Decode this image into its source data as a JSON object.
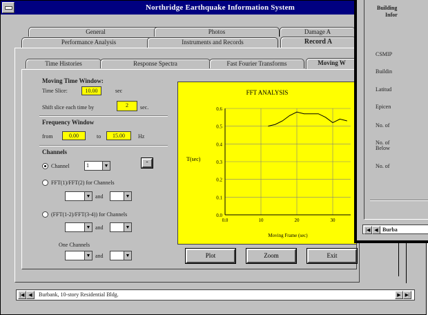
{
  "window": {
    "title": "Northridge Earthquake Information System"
  },
  "tabs_row1": [
    "General",
    "Photos",
    "Damage A"
  ],
  "tabs_row2": [
    "Performance Analysis",
    "Instruments and Records",
    "Record A"
  ],
  "tabs_row3": [
    "Time Histories",
    "Response Spectra",
    "Fast Fourier Transforms",
    "Moving W"
  ],
  "moving_window": {
    "heading": "Moving Time Window:",
    "time_slice_label": "Time Slice:",
    "time_slice_value": "10.00",
    "time_slice_unit": "sec",
    "shift_label": "Shift slice each time by",
    "shift_value": "2",
    "shift_unit": "sec."
  },
  "frequency_window": {
    "heading": "Frequency Window",
    "from_label": "from",
    "from_value": "0.00",
    "to_label": "to",
    "to_value": "15.00",
    "unit": "Hz"
  },
  "channels": {
    "heading": "Channels",
    "channel_label": "Channel",
    "channel_value": "1",
    "option2": "FFT(1)/FFT(2) for Channels",
    "option3": "(FFT(1-2)/FFT(3-4)) for Channels",
    "and_label": "and",
    "one_channels_label": "One Channels",
    "minus_button": "-"
  },
  "buttons": {
    "plot": "Plot",
    "zoom": "Zoom",
    "exit": "Exit"
  },
  "chart_data": {
    "type": "line",
    "title": "FFT ANALYSIS",
    "xlabel": "Moving Frame (sec)",
    "ylabel": "T(sec)",
    "xlim": [
      0,
      35
    ],
    "ylim": [
      0,
      0.6
    ],
    "x_ticks": [
      "0.0",
      "10",
      "20",
      "30"
    ],
    "y_ticks": [
      "0.0",
      "0.1",
      "0.2",
      "0.3",
      "0.4",
      "0.5",
      "0.6"
    ],
    "grid": true,
    "series": [
      {
        "x": [
          12,
          14,
          16,
          18,
          20,
          22,
          24,
          26,
          28,
          30,
          32,
          34
        ],
        "y": [
          0.5,
          0.51,
          0.53,
          0.56,
          0.58,
          0.57,
          0.57,
          0.57,
          0.55,
          0.52,
          0.54,
          0.53
        ]
      }
    ],
    "line_color": "#000000"
  },
  "status": {
    "text": "Burbank, 10-story Residential Bldg."
  },
  "overlay": {
    "header_line1": "Building",
    "header_line2": "Infor",
    "rows": [
      "CSMIP",
      "Buildin",
      "Latitud",
      "Epicen",
      "No. of",
      "No. of",
      "Below",
      "No. of"
    ],
    "nav_text": "Burba"
  },
  "colors": {
    "title_bar": "#000080",
    "field_highlight": "#ffff00",
    "chart_bg": "#ffff00",
    "face": "#c0c0c0"
  }
}
